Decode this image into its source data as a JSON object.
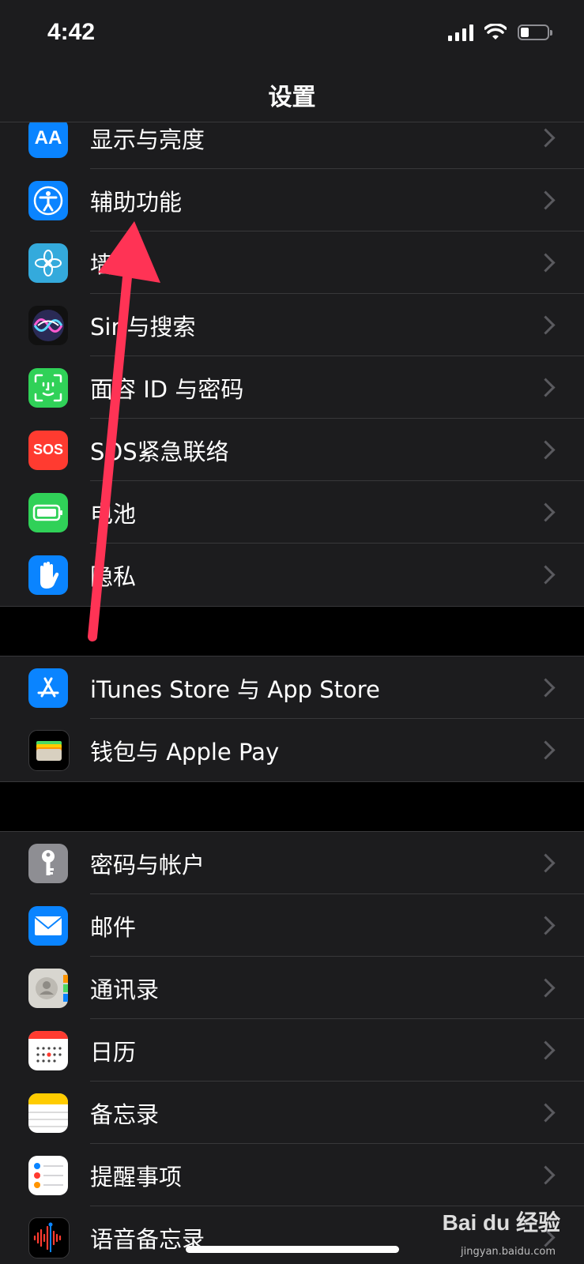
{
  "status_bar": {
    "time": "4:42"
  },
  "nav": {
    "title": "设置"
  },
  "groups": [
    {
      "rows": [
        {
          "label": "显示与亮度",
          "icon": "display-brightness-icon",
          "color": "#0a84ff"
        },
        {
          "label": "辅助功能",
          "icon": "accessibility-icon",
          "color": "#0a84ff"
        },
        {
          "label": "墙纸",
          "icon": "wallpaper-flower-icon",
          "color": "#34aadc"
        },
        {
          "label": "Siri与搜索",
          "icon": "siri-icon",
          "color": "#1c1c3a"
        },
        {
          "label": "面容 ID 与密码",
          "icon": "face-id-icon",
          "color": "#30d158"
        },
        {
          "label": "SOS紧急联络",
          "icon": "sos-icon",
          "color": "#ff3b30"
        },
        {
          "label": "电池",
          "icon": "battery-icon",
          "color": "#30d158"
        },
        {
          "label": "隐私",
          "icon": "hand-icon",
          "color": "#0a84ff"
        }
      ]
    },
    {
      "rows": [
        {
          "label": "iTunes Store 与 App Store",
          "icon": "app-store-icon",
          "color": "#0a84ff"
        },
        {
          "label": "钱包与 Apple Pay",
          "icon": "wallet-icon",
          "color": "#000000"
        }
      ]
    },
    {
      "rows": [
        {
          "label": "密码与帐户",
          "icon": "key-icon",
          "color": "#8e8e93"
        },
        {
          "label": "邮件",
          "icon": "mail-icon",
          "color": "#0a84ff"
        },
        {
          "label": "通讯录",
          "icon": "contacts-icon",
          "color": "#c7c7cc"
        },
        {
          "label": "日历",
          "icon": "calendar-icon",
          "color": "#ffffff"
        },
        {
          "label": "备忘录",
          "icon": "notes-icon",
          "color": "#ffffff"
        },
        {
          "label": "提醒事项",
          "icon": "reminders-icon",
          "color": "#ffffff"
        },
        {
          "label": "语音备忘录",
          "icon": "voice-memos-icon",
          "color": "#000000"
        }
      ]
    }
  ],
  "watermark": {
    "text": "Bai du 经验",
    "sub": "jingyan.baidu.com"
  },
  "annotation": {
    "arrow_color": "#ff3355"
  }
}
